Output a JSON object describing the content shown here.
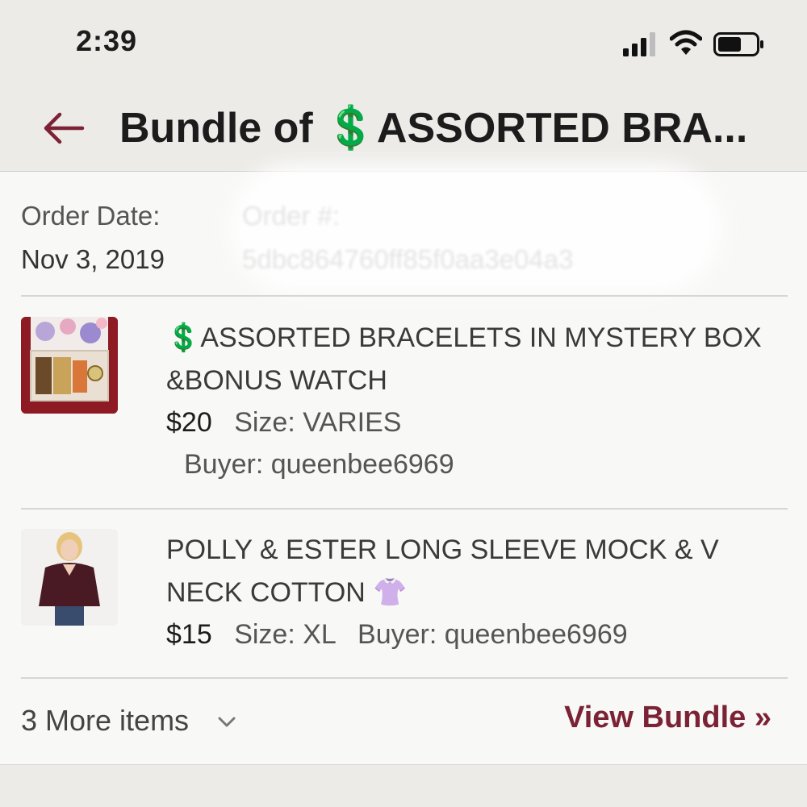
{
  "status_bar": {
    "time": "2:39"
  },
  "header": {
    "title": "Bundle of 💲ASSORTED BRA..."
  },
  "order": {
    "date_label": "Order Date:",
    "date_value": "Nov 3, 2019",
    "number_label": "Order #:",
    "number_value": "5dbc864760ff85f0aa3e04a3"
  },
  "items": [
    {
      "title": "💲ASSORTED BRACELETS IN MYSTERY BOX &BONUS WATCH",
      "price": "$20",
      "size_label": "Size:",
      "size_value": "VARIES",
      "buyer_label": "Buyer:",
      "buyer_value": "queenbee6969"
    },
    {
      "title": "POLLY & ESTER LONG SLEEVE MOCK & V NECK COTTON 👚",
      "price": "$15",
      "size_label": "Size:",
      "size_value": "XL",
      "buyer_label": "Buyer:",
      "buyer_value": "queenbee6969"
    }
  ],
  "footer": {
    "more_items": "3 More items",
    "view_bundle": "View Bundle »"
  },
  "colors": {
    "accent": "#7b2334",
    "header_bg": "#ecebe8",
    "card_bg": "#f8f8f7"
  }
}
